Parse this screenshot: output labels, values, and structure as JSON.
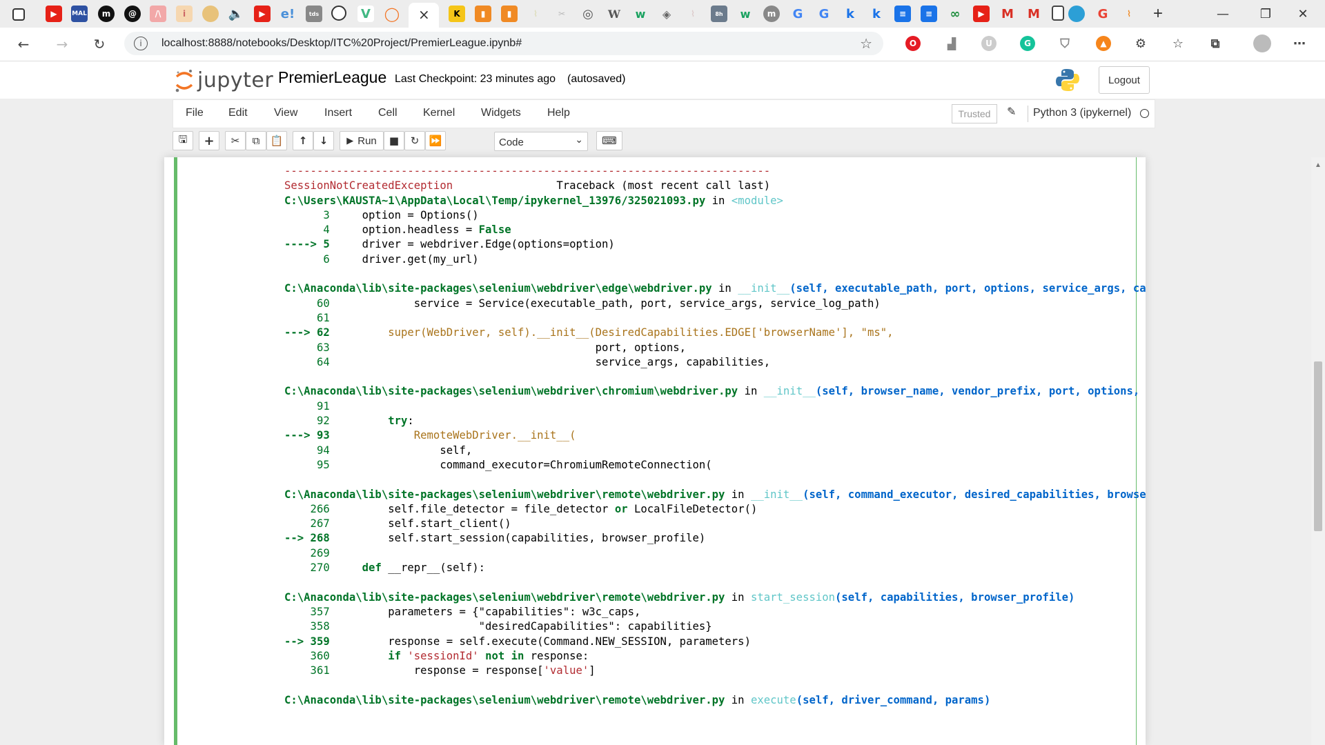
{
  "browser": {
    "url": "localhost:8888/notebooks/Desktop/ITC%20Project/PremierLeague.ipynb#",
    "active_tab_close": "×",
    "new_tab": "+"
  },
  "jupyter": {
    "logo_text": "jupyter",
    "notebook_name": "PremierLeague",
    "checkpoint": "Last Checkpoint: 23 minutes ago",
    "autosaved": "(autosaved)",
    "logout": "Logout",
    "menu": [
      "File",
      "Edit",
      "View",
      "Insert",
      "Cell",
      "Kernel",
      "Widgets",
      "Help"
    ],
    "trusted": "Trusted",
    "kernel": "Python 3 (ipykernel)",
    "run_label": "Run",
    "cell_type": "Code"
  },
  "traceback": {
    "rule": "---------------------------------------------------------------------------",
    "exception": "SessionNotCreatedException",
    "header_right": "Traceback (most recent call last)",
    "frames": [
      {
        "path": "C:\\Users\\KAUSTA~1\\AppData\\Local\\Temp/ipykernel_13976/325021093.py",
        "in": "in",
        "func": "<module>",
        "sig": ""
      },
      {
        "path": "C:\\Anaconda\\lib\\site-packages\\selenium\\webdriver\\edge\\webdriver.py",
        "in": "in",
        "func": "__init__",
        "sig": "(self, executable_path, port, options, service_args, capabilities, service_log_path, service, keep_alive, verbose)"
      },
      {
        "path": "C:\\Anaconda\\lib\\site-packages\\selenium\\webdriver\\chromium\\webdriver.py",
        "in": "in",
        "func": "__init__",
        "sig": "(self, browser_name, vendor_prefix, port, options, service_args, desired_capabilities, service_log_path, service, keep_alive)"
      },
      {
        "path": "C:\\Anaconda\\lib\\site-packages\\selenium\\webdriver\\remote\\webdriver.py",
        "in": "in",
        "func": "__init__",
        "sig": "(self, command_executor, desired_capabilities, browser_profile, proxy, keep_alive, file_detector, options)"
      },
      {
        "path": "C:\\Anaconda\\lib\\site-packages\\selenium\\webdriver\\remote\\webdriver.py",
        "in": "in",
        "func": "start_session",
        "sig": "(self, capabilities, browser_profile)"
      },
      {
        "path": "C:\\Anaconda\\lib\\site-packages\\selenium\\webdriver\\remote\\webdriver.py",
        "in": "in",
        "func": "execute",
        "sig": "(self, driver_command, params)"
      }
    ]
  },
  "colors": {
    "cell_border": "#66bb6a",
    "error_red": "#b22b31",
    "path_green": "#007427",
    "func_cyan": "#60c6c8",
    "sig_blue": "#0065ca",
    "highlight_yellow": "#a9741c"
  }
}
